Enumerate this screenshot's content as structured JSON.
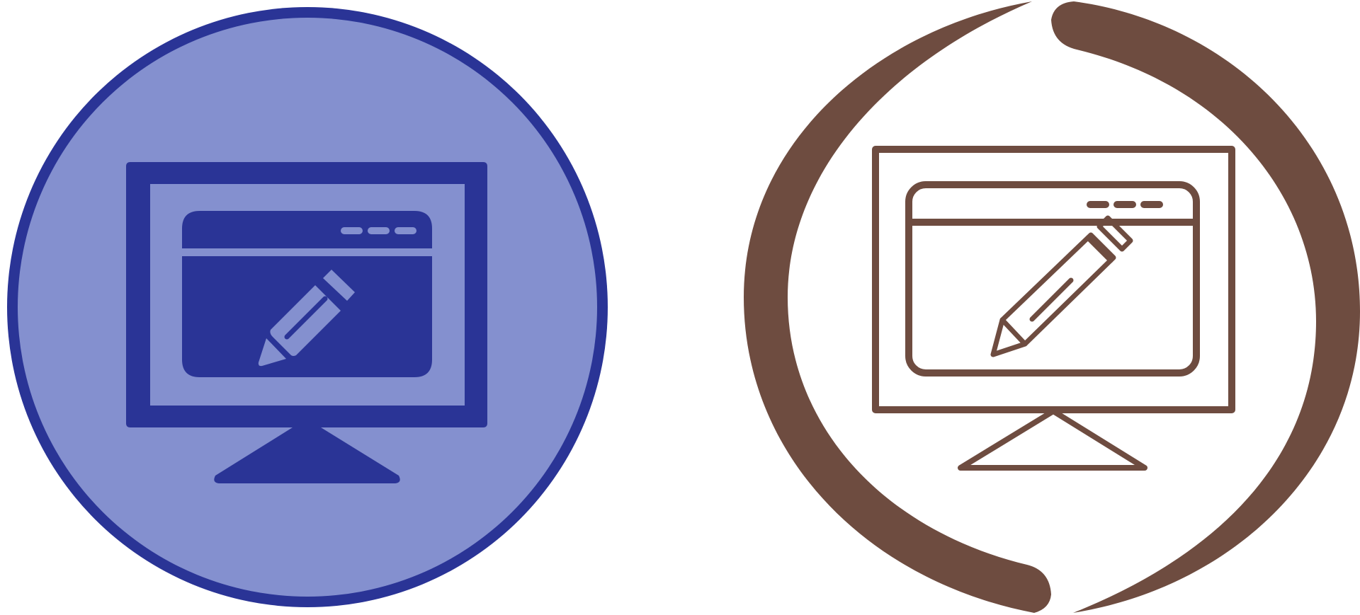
{
  "icons": [
    {
      "name": "monitor-edit-glyph-icon",
      "style": "glyph",
      "colors": {
        "ring": "#2a3496",
        "fill": "#8490cf",
        "glyph": "#2a3496"
      }
    },
    {
      "name": "monitor-edit-outline-icon",
      "style": "outline",
      "colors": {
        "arc": "#6e4c40",
        "stroke": "#6e4c40"
      }
    }
  ]
}
